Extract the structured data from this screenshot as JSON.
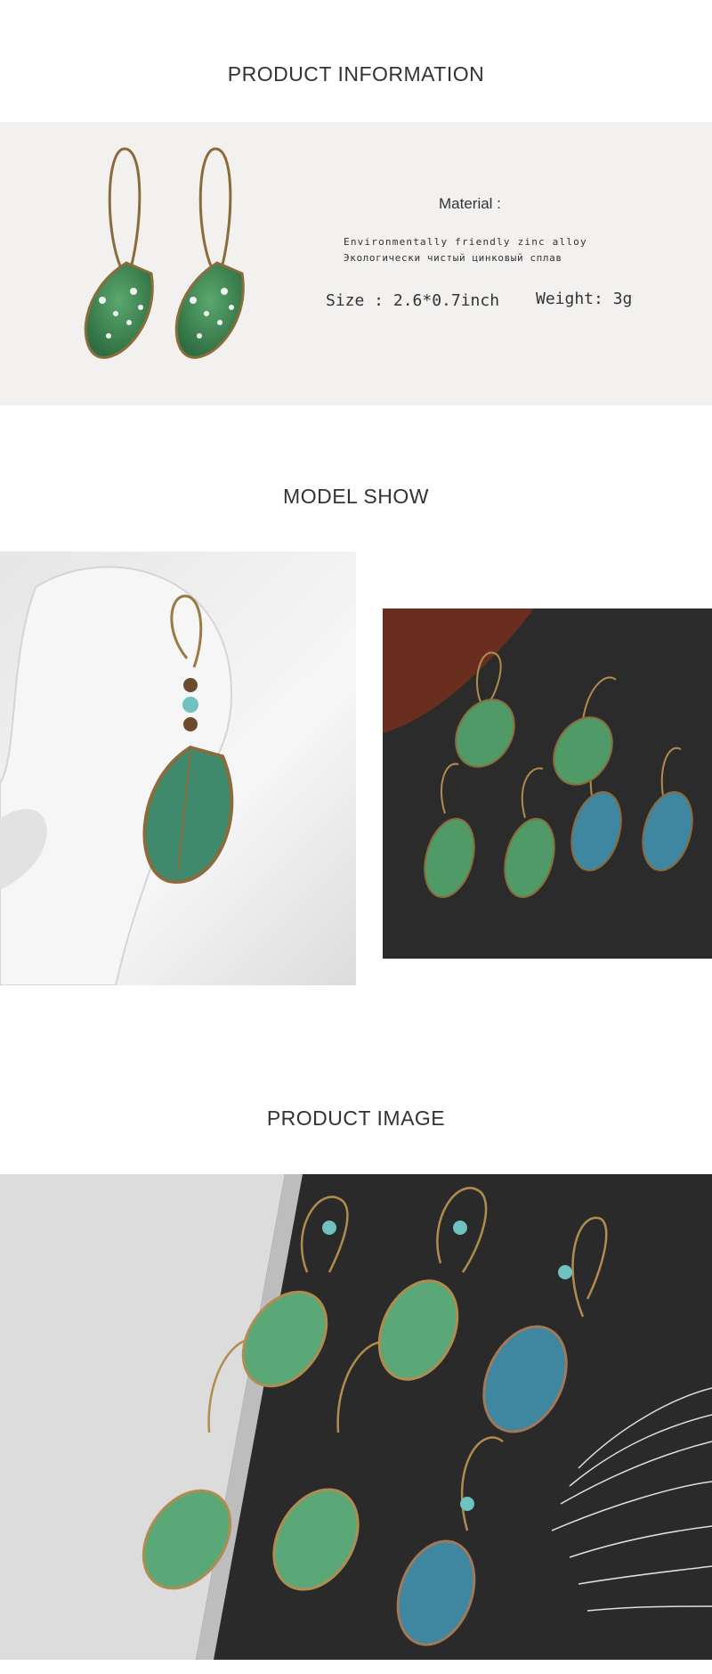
{
  "headings": {
    "product_information": "PRODUCT INFORMATION",
    "model_show": "MODEL SHOW",
    "product_image": "PRODUCT IMAGE"
  },
  "info": {
    "material_label": "Material :",
    "material_en": "Environmentally friendly zinc alloy",
    "material_ru": "Экологически чистый цинковый сплав",
    "size": "Size : 2.6*0.7inch",
    "weight": "Weight: 3g"
  },
  "colors": {
    "panel": "#f2f1f0",
    "leaf_green": "#3f8a58",
    "leaf_blue": "#3f86a0",
    "bronze": "#9a7a45",
    "dark_board": "#2a2a2a"
  }
}
